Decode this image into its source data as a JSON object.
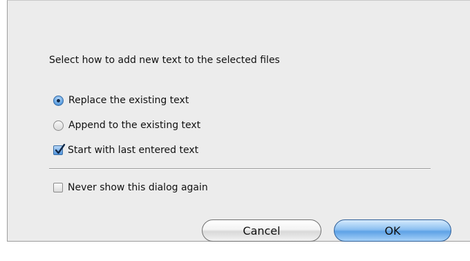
{
  "dialog": {
    "prompt": "Select how to add new text to the selected files",
    "options": {
      "replace": {
        "label": "Replace the existing text",
        "selected": true
      },
      "append": {
        "label": "Append to the existing text",
        "selected": false
      },
      "start_last": {
        "label": "Start with last entered text",
        "checked": true
      },
      "never_show": {
        "label": "Never show this dialog again",
        "checked": false
      }
    },
    "buttons": {
      "cancel": "Cancel",
      "ok": "OK"
    }
  },
  "colors": {
    "background": "#ececec",
    "accent": "#5ea2e6"
  }
}
